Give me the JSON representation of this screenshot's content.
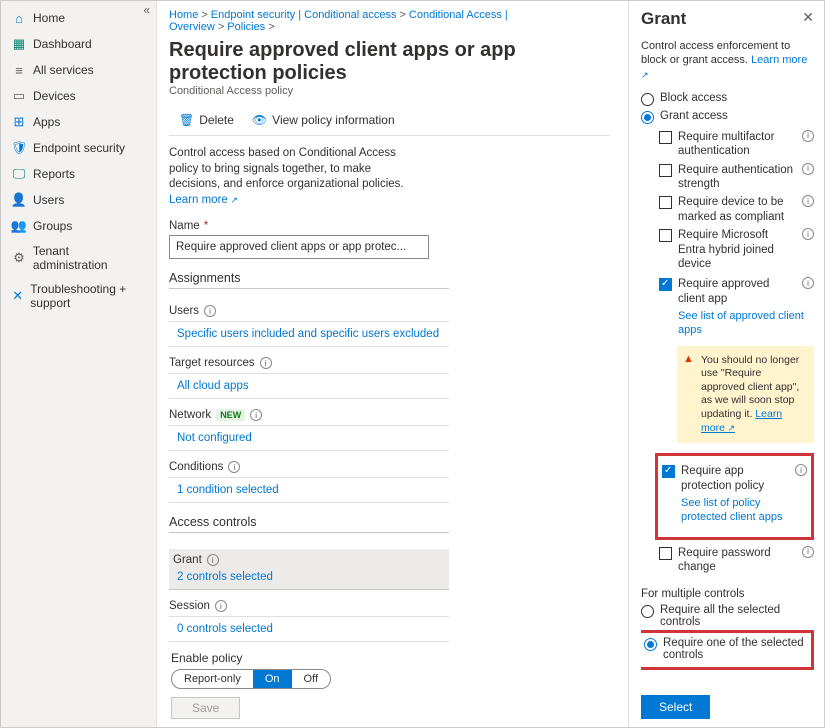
{
  "sidebar": {
    "items": [
      {
        "icon": "⌂",
        "label": "Home",
        "cls": "blue"
      },
      {
        "icon": "▦",
        "label": "Dashboard",
        "cls": "teal"
      },
      {
        "icon": "≡",
        "label": "All services",
        "cls": "gray"
      },
      {
        "icon": "▭",
        "label": "Devices",
        "cls": "gray"
      },
      {
        "icon": "⊞",
        "label": "Apps",
        "cls": "blue"
      },
      {
        "icon": "🛡",
        "label": "Endpoint security",
        "cls": "blue"
      },
      {
        "icon": "🖵",
        "label": "Reports",
        "cls": "teal"
      },
      {
        "icon": "👤",
        "label": "Users",
        "cls": "blue"
      },
      {
        "icon": "👥",
        "label": "Groups",
        "cls": "blue"
      },
      {
        "icon": "⚙",
        "label": "Tenant administration",
        "cls": "gray"
      },
      {
        "icon": "✕",
        "label": "Troubleshooting + support",
        "cls": "blue"
      }
    ]
  },
  "breadcrumbs": [
    "Home",
    "Endpoint security | Conditional access",
    "Conditional Access | Overview",
    "Policies"
  ],
  "page": {
    "title": "Require approved client apps or app protection policies",
    "subtitle": "Conditional Access policy",
    "delete": "Delete",
    "viewInfo": "View policy information",
    "description": "Control access based on Conditional Access policy to bring signals together, to make decisions, and enforce organizational policies.",
    "learnMore": "Learn more",
    "nameLabel": "Name",
    "nameValue": "Require approved client apps or app protec...",
    "assignments": "Assignments",
    "usersLabel": "Users",
    "usersValue": "Specific users included and specific users excluded",
    "targetLabel": "Target resources",
    "targetValue": "All cloud apps",
    "networkLabel": "Network",
    "networkNew": "NEW",
    "networkValue": "Not configured",
    "conditionsLabel": "Conditions",
    "conditionsValue": "1 condition selected",
    "accessControls": "Access controls",
    "grantLabel": "Grant",
    "grantValue": "2 controls selected",
    "sessionLabel": "Session",
    "sessionValue": "0 controls selected",
    "enableLabel": "Enable policy",
    "segReport": "Report-only",
    "segOn": "On",
    "segOff": "Off",
    "save": "Save"
  },
  "panel": {
    "title": "Grant",
    "desc": "Control access enforcement to block or grant access.",
    "learnMore": "Learn more",
    "block": "Block access",
    "grant": "Grant access",
    "checks": [
      {
        "label": "Require multifactor authentication",
        "checked": false
      },
      {
        "label": "Require authentication strength",
        "checked": false
      },
      {
        "label": "Require device to be marked as compliant",
        "checked": false
      },
      {
        "label": "Require Microsoft Entra hybrid joined device",
        "checked": false
      }
    ],
    "approvedApp": "Require approved client app",
    "approvedAppLink": "See list of approved client apps",
    "warn": "You should no longer use \"Require approved client app\", as we will soon stop updating it.",
    "warnLearn": "Learn more",
    "appProtection": "Require app protection policy",
    "appProtectionLink": "See list of policy protected client apps",
    "pwdChange": "Require password change",
    "multiHead": "For multiple controls",
    "reqAll": "Require all the selected controls",
    "reqOne": "Require one of the selected controls",
    "select": "Select"
  }
}
